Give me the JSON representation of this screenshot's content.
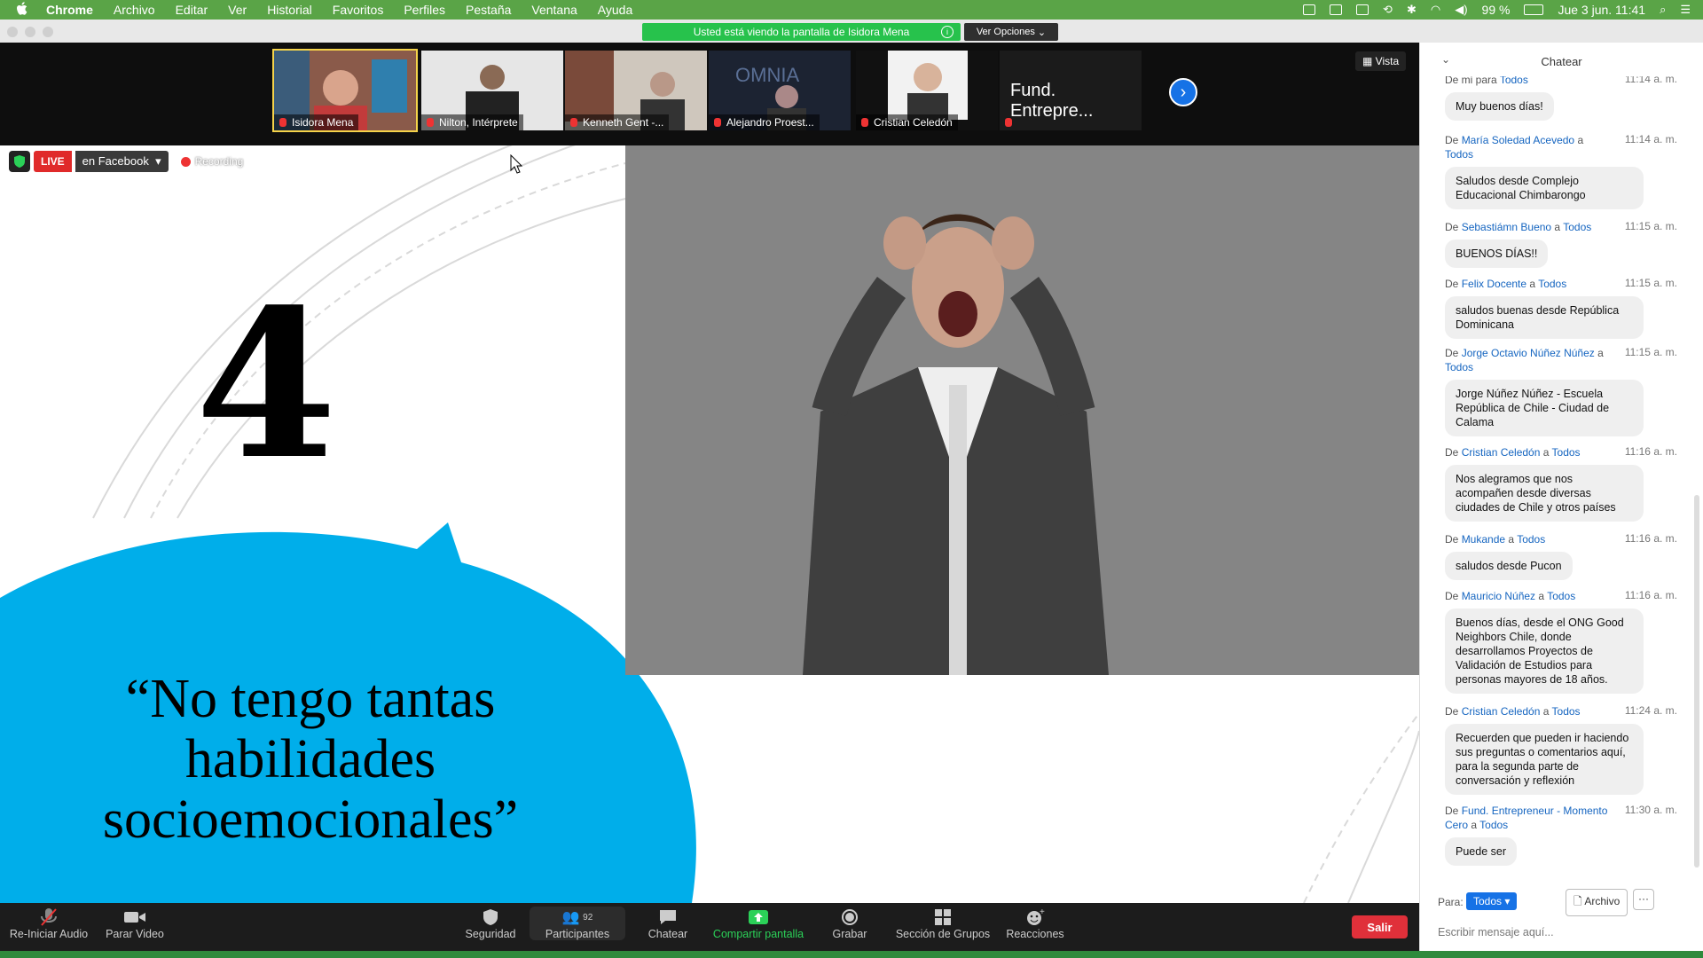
{
  "menubar": {
    "app": "Chrome",
    "items": [
      "Archivo",
      "Editar",
      "Ver",
      "Historial",
      "Favoritos",
      "Perfiles",
      "Pestaña",
      "Ventana",
      "Ayuda"
    ],
    "battery": "99 %",
    "datetime": "Jue 3 jun.  11:41"
  },
  "banner": {
    "viewing_text": "Usted está viendo la pantalla de Isidora Mena",
    "options_label": "Ver Opciones"
  },
  "videos": {
    "tiles": [
      {
        "name": "Isidora Mena"
      },
      {
        "name": "Nilton, Intérprete"
      },
      {
        "name": "Kenneth Gent -..."
      },
      {
        "name": "Alejandro Proest..."
      },
      {
        "name": "Cristian Celedón"
      },
      {
        "name": "Fund. Entrepre..."
      }
    ],
    "view_label": "Vista"
  },
  "slide": {
    "live_label": "LIVE",
    "platform_label": "en Facebook",
    "recording_label": "Recording",
    "number": "4",
    "quote": "“No tengo tantas habilidades socioemocionales”"
  },
  "toolbar": {
    "audio": "Re-Iniciar Audio",
    "video": "Parar Video",
    "security": "Seguridad",
    "participants": "Participantes",
    "participants_count": "92",
    "chat": "Chatear",
    "share": "Compartir pantalla",
    "record": "Grabar",
    "breakout": "Sección de Grupos",
    "reactions": "Reacciones",
    "leave": "Salir"
  },
  "chat": {
    "title": "Chatear",
    "messages": [
      {
        "from": "De mi para",
        "to": "Todos",
        "sender": "",
        "time": "11:14 a. m.",
        "text": "Muy buenos días!"
      },
      {
        "from": "De",
        "sender": "María Soledad Acevedo",
        "to": "Todos",
        "time": "11:14 a. m.",
        "text": "Saludos desde Complejo Educacional Chimbarongo"
      },
      {
        "from": "De",
        "sender": "Sebastiámn Bueno",
        "to": "Todos",
        "time": "11:15 a. m.",
        "text": "BUENOS DÍAS!!"
      },
      {
        "from": "De",
        "sender": "Felix Docente",
        "to": "Todos",
        "time": "11:15 a. m.",
        "text": "saludos buenas desde República Dominicana"
      },
      {
        "from": "De",
        "sender": "Jorge Octavio Núñez Núñez",
        "to": "Todos",
        "time": "11:15 a. m.",
        "text": "Jorge Núñez Núñez - Escuela República de Chile - Ciudad de Calama"
      },
      {
        "from": "De",
        "sender": "Cristian Celedón",
        "to": "Todos",
        "time": "11:16 a. m.",
        "text": "Nos alegramos que nos acompañen desde diversas ciudades de Chile y otros países"
      },
      {
        "from": "De",
        "sender": "Mukande",
        "to": "Todos",
        "time": "11:16 a. m.",
        "text": "saludos desde Pucon"
      },
      {
        "from": "De",
        "sender": "Mauricio Núñez",
        "to": "Todos",
        "time": "11:16 a. m.",
        "text": "Buenos días, desde el ONG Good Neighbors Chile, donde desarrollamos Proyectos de Validación de Estudios para personas mayores de 18 años."
      },
      {
        "from": "De",
        "sender": "Cristian Celedón",
        "to": "Todos",
        "time": "11:24 a. m.",
        "text": "Recuerden que pueden ir haciendo sus preguntas o comentarios aquí, para la segunda parte de conversación y reflexión"
      },
      {
        "from": "De",
        "sender": "Fund. Entrepreneur - Momento Cero",
        "to": "Todos",
        "time": "11:30 a. m.",
        "text": "Puede ser"
      }
    ],
    "to_label": "Para:",
    "to_value": "Todos",
    "file_label": "Archivo",
    "more_label": "···",
    "placeholder": "Escribir mensaje aquí..."
  }
}
